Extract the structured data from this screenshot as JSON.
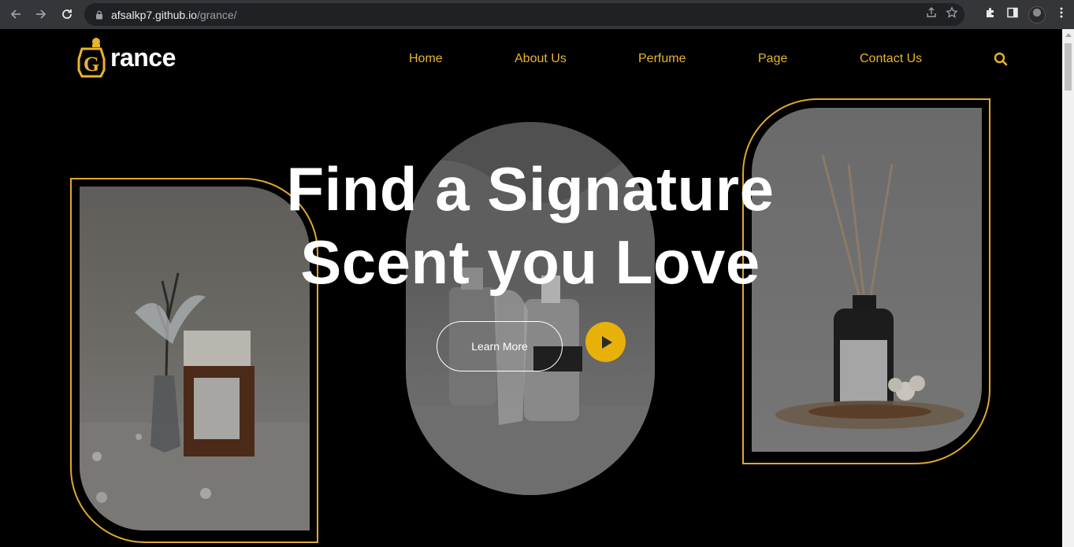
{
  "browser": {
    "url_host": "afsalkp7.github.io",
    "url_path": "/grance/"
  },
  "site": {
    "logo_text": "rance",
    "logo_letter": "G",
    "nav": [
      {
        "label": "Home"
      },
      {
        "label": "About Us"
      },
      {
        "label": "Perfume"
      },
      {
        "label": "Page"
      },
      {
        "label": "Contact Us"
      }
    ]
  },
  "hero": {
    "title_line1": "Find a Signature",
    "title_line2": "Scent you Love",
    "learn_more": "Learn More"
  },
  "colors": {
    "accent": "#e8b62a",
    "play_button": "#e8b10a",
    "background": "#000000"
  }
}
